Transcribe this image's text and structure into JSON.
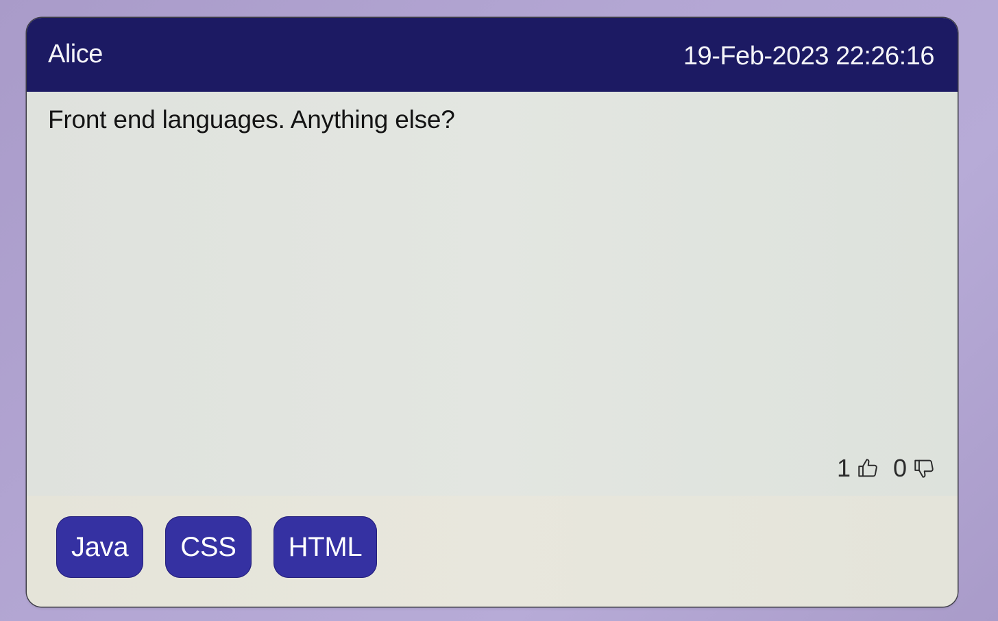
{
  "post": {
    "author": "Alice",
    "timestamp": "19-Feb-2023 22:26:16",
    "body": "Front end languages. Anything else?",
    "votes": {
      "up_count": "1",
      "up_icon": "thumbs-up-icon",
      "down_count": "0",
      "down_icon": "thumbs-down-icon"
    },
    "tags": [
      {
        "label": "Java"
      },
      {
        "label": "CSS"
      },
      {
        "label": "HTML"
      }
    ]
  },
  "colors": {
    "header_bg": "#1c1a63",
    "tag_bg": "#3531a2",
    "card_bg": "#e1e4df",
    "page_bg": "#b1a4d1"
  }
}
